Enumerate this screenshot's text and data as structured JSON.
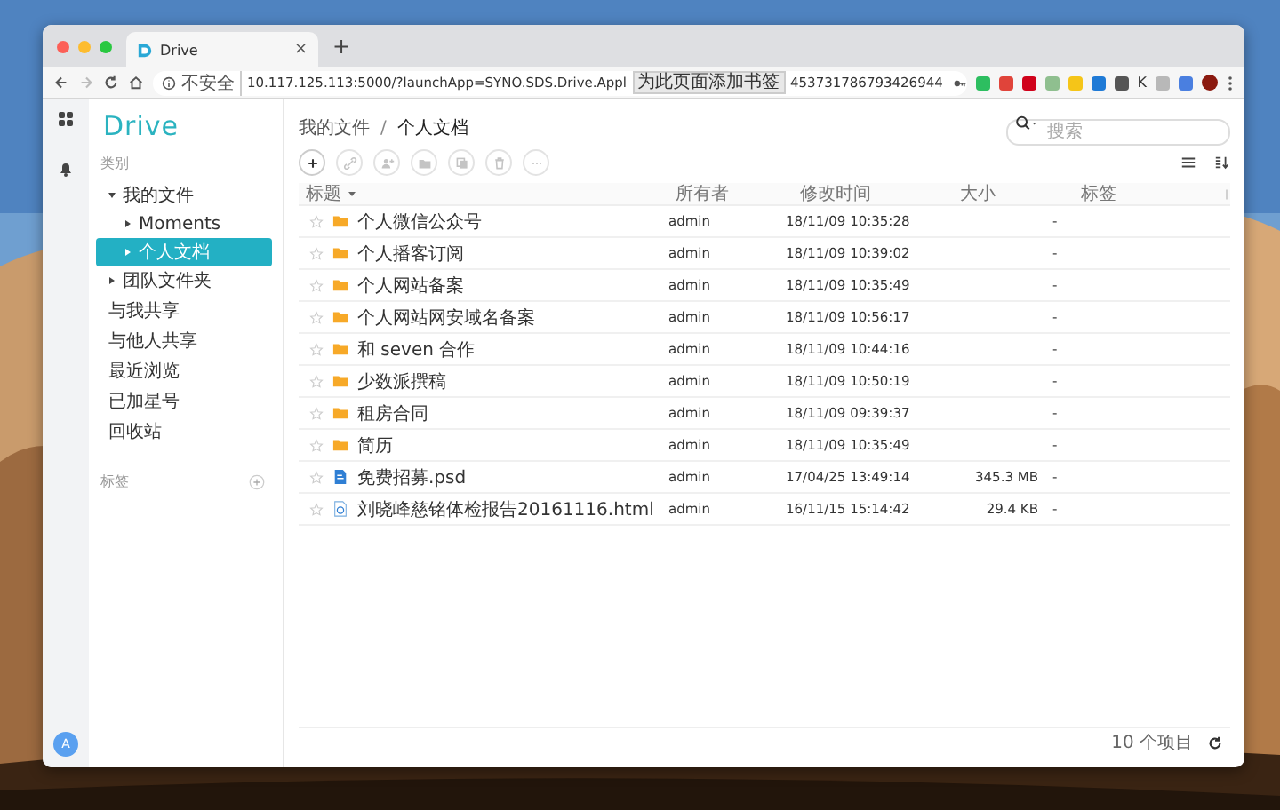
{
  "browser": {
    "tab": {
      "title": "Drive",
      "close": "×"
    },
    "new_tab": "+",
    "address": {
      "security": "不安全",
      "url_start": "10.117.125.113:5000/?launchApp=SYNO.SDS.Drive.Appl",
      "tooltip": "为此页面添加书签",
      "url_end": "453731786793426944"
    },
    "extensions": [
      {
        "kind": "icon",
        "color": "#2dbe60"
      },
      {
        "kind": "icon",
        "color": "#e0443a"
      },
      {
        "kind": "icon",
        "color": "#d0021b"
      },
      {
        "kind": "icon",
        "color": "#8fbf8f"
      },
      {
        "kind": "icon",
        "color": "#f5c518"
      },
      {
        "kind": "icon",
        "color": "#1f7ad6"
      },
      {
        "kind": "icon",
        "color": "#555555"
      },
      {
        "kind": "text",
        "label": "K"
      },
      {
        "kind": "icon",
        "color": "#b8b8b8"
      },
      {
        "kind": "icon",
        "color": "#4a7fe0"
      }
    ]
  },
  "app": {
    "logo": "Drive",
    "category_label": "类别",
    "tree": [
      {
        "label": "我的文件",
        "expanded": true,
        "selected": false,
        "children": [
          {
            "label": "Moments",
            "expanded": false,
            "selected": false
          },
          {
            "label": "个人文档",
            "expanded": false,
            "selected": true
          }
        ]
      },
      {
        "label": "团队文件夹",
        "expanded": false,
        "selected": false
      }
    ],
    "nav": [
      "与我共享",
      "与他人共享",
      "最近浏览",
      "已加星号",
      "回收站"
    ],
    "tags_label": "标签",
    "avatar": "A",
    "breadcrumb": [
      "我的文件",
      "个人文档"
    ],
    "breadcrumb_separator": "/",
    "toolbar": [
      {
        "kind": "add",
        "disabled": false
      },
      {
        "kind": "link",
        "disabled": true
      },
      {
        "kind": "share",
        "disabled": true
      },
      {
        "kind": "move",
        "disabled": true
      },
      {
        "kind": "copy",
        "disabled": true
      },
      {
        "kind": "delete",
        "disabled": true
      },
      {
        "kind": "more",
        "disabled": true
      }
    ],
    "search": {
      "placeholder": "搜索"
    },
    "table": {
      "columns": [
        {
          "label": "标题",
          "sorted": true
        },
        {
          "label": "所有者",
          "sorted": false
        },
        {
          "label": "修改时间",
          "sorted": false
        },
        {
          "label": "大小",
          "sorted": false
        },
        {
          "label": "标签",
          "sorted": false
        }
      ],
      "rows": [
        {
          "kind": "folder",
          "name": "个人微信公众号",
          "owner": "admin",
          "modified": "18/11/09 10:35:28",
          "tags": "-"
        },
        {
          "kind": "folder",
          "name": "个人播客订阅",
          "owner": "admin",
          "modified": "18/11/09 10:39:02",
          "tags": "-"
        },
        {
          "kind": "folder",
          "name": "个人网站备案",
          "owner": "admin",
          "modified": "18/11/09 10:35:49",
          "tags": "-"
        },
        {
          "kind": "folder",
          "name": "个人网站网安域名备案",
          "owner": "admin",
          "modified": "18/11/09 10:56:17",
          "tags": "-"
        },
        {
          "kind": "folder",
          "name": "和 seven 合作",
          "owner": "admin",
          "modified": "18/11/09 10:44:16",
          "tags": "-"
        },
        {
          "kind": "folder",
          "name": "少数派撰稿",
          "owner": "admin",
          "modified": "18/11/09 10:50:19",
          "tags": "-"
        },
        {
          "kind": "folder",
          "name": "租房合同",
          "owner": "admin",
          "modified": "18/11/09 09:39:37",
          "tags": "-"
        },
        {
          "kind": "folder",
          "name": "简历",
          "owner": "admin",
          "modified": "18/11/09 10:35:49",
          "tags": "-"
        },
        {
          "kind": "psd",
          "name": "免费招募.psd",
          "owner": "admin",
          "modified": "17/04/25 13:49:14",
          "size": "345.3 MB",
          "tags": "-"
        },
        {
          "kind": "html",
          "name": "刘晓峰慈铭体检报告20161116.html",
          "owner": "admin",
          "modified": "16/11/15 15:14:42",
          "size": "29.4 KB",
          "tags": "-"
        }
      ]
    },
    "footer": {
      "count": "10 个项目"
    }
  }
}
